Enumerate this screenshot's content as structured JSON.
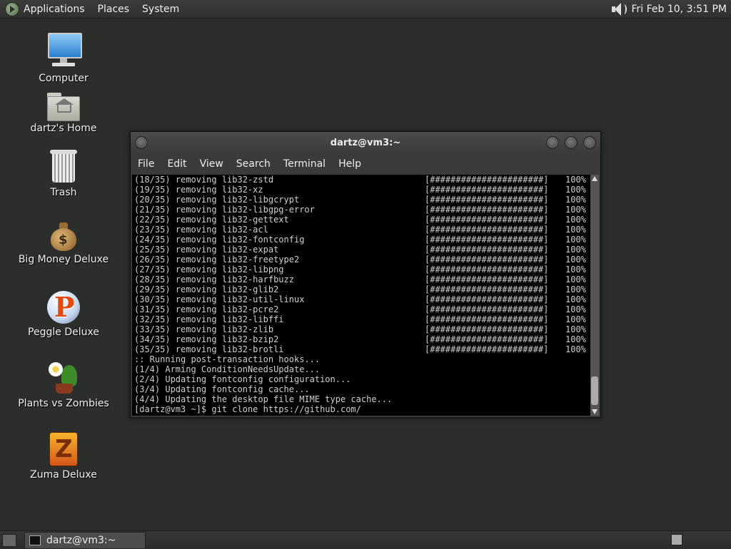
{
  "top_panel": {
    "menus": [
      "Applications",
      "Places",
      "System"
    ],
    "clock": "Fri Feb 10,  3:51 PM"
  },
  "desktop_icons": [
    {
      "label": "Computer",
      "icon": "computer-icon"
    },
    {
      "label": "dartz's Home",
      "icon": "home-folder-icon"
    },
    {
      "label": "Trash",
      "icon": "trash-icon"
    },
    {
      "label": "Big Money Deluxe",
      "icon": "money-bag-icon"
    },
    {
      "label": "Peggle Deluxe",
      "icon": "peggle-icon"
    },
    {
      "label": "Plants vs Zombies",
      "icon": "plants-icon"
    },
    {
      "label": "Zuma Deluxe",
      "icon": "zuma-icon"
    }
  ],
  "terminal": {
    "title": "dartz@vm3:~",
    "menus": [
      "File",
      "Edit",
      "View",
      "Search",
      "Terminal",
      "Help"
    ],
    "progress_rows": [
      {
        "text": "(18/35) removing lib32-zstd",
        "bar": "[######################]",
        "pct": "100%"
      },
      {
        "text": "(19/35) removing lib32-xz",
        "bar": "[######################]",
        "pct": "100%"
      },
      {
        "text": "(20/35) removing lib32-libgcrypt",
        "bar": "[######################]",
        "pct": "100%"
      },
      {
        "text": "(21/35) removing lib32-libgpg-error",
        "bar": "[######################]",
        "pct": "100%"
      },
      {
        "text": "(22/35) removing lib32-gettext",
        "bar": "[######################]",
        "pct": "100%"
      },
      {
        "text": "(23/35) removing lib32-acl",
        "bar": "[######################]",
        "pct": "100%"
      },
      {
        "text": "(24/35) removing lib32-fontconfig",
        "bar": "[######################]",
        "pct": "100%"
      },
      {
        "text": "(25/35) removing lib32-expat",
        "bar": "[######################]",
        "pct": "100%"
      },
      {
        "text": "(26/35) removing lib32-freetype2",
        "bar": "[######################]",
        "pct": "100%"
      },
      {
        "text": "(27/35) removing lib32-libpng",
        "bar": "[######################]",
        "pct": "100%"
      },
      {
        "text": "(28/35) removing lib32-harfbuzz",
        "bar": "[######################]",
        "pct": "100%"
      },
      {
        "text": "(29/35) removing lib32-glib2",
        "bar": "[######################]",
        "pct": "100%"
      },
      {
        "text": "(30/35) removing lib32-util-linux",
        "bar": "[######################]",
        "pct": "100%"
      },
      {
        "text": "(31/35) removing lib32-pcre2",
        "bar": "[######################]",
        "pct": "100%"
      },
      {
        "text": "(32/35) removing lib32-libffi",
        "bar": "[######################]",
        "pct": "100%"
      },
      {
        "text": "(33/35) removing lib32-zlib",
        "bar": "[######################]",
        "pct": "100%"
      },
      {
        "text": "(34/35) removing lib32-bzip2",
        "bar": "[######################]",
        "pct": "100%"
      },
      {
        "text": "(35/35) removing lib32-brotli",
        "bar": "[######################]",
        "pct": "100%"
      }
    ],
    "output_lines": [
      ":: Running post-transaction hooks...",
      "(1/4) Arming ConditionNeedsUpdate...",
      "(2/4) Updating fontconfig configuration...",
      "(3/4) Updating fontconfig cache...",
      "(4/4) Updating the desktop file MIME type cache...",
      "[dartz@vm3 ~]$ git clone https://github.com/"
    ]
  },
  "taskbar": {
    "task_label": "dartz@vm3:~"
  }
}
